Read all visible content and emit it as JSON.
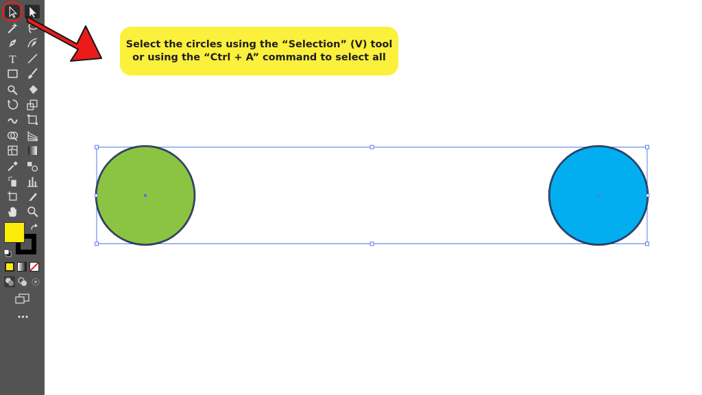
{
  "callout": {
    "line1": "Select the circles using the “Selection” (V) tool",
    "line2": "or using the “Ctrl + A” command to select all"
  },
  "toolbar": {
    "tools": [
      {
        "name": "selection-tool",
        "icon": "selection-arrow-icon",
        "active": true
      },
      {
        "name": "direct-selection-tool",
        "icon": "direct-selection-arrow-icon"
      },
      {
        "name": "magic-wand-tool",
        "icon": "magic-wand-icon"
      },
      {
        "name": "lasso-tool",
        "icon": "lasso-icon"
      },
      {
        "name": "pen-tool",
        "icon": "pen-icon"
      },
      {
        "name": "curvature-tool",
        "icon": "curvature-icon"
      },
      {
        "name": "type-tool",
        "icon": "type-icon",
        "glyph": "T"
      },
      {
        "name": "line-segment-tool",
        "icon": "line-segment-icon"
      },
      {
        "name": "rectangle-tool",
        "icon": "rectangle-icon"
      },
      {
        "name": "paintbrush-tool",
        "icon": "paintbrush-icon"
      },
      {
        "name": "shaper-tool",
        "icon": "shaper-icon"
      },
      {
        "name": "eraser-tool",
        "icon": "eraser-icon"
      },
      {
        "name": "rotate-tool",
        "icon": "rotate-icon"
      },
      {
        "name": "scale-tool",
        "icon": "scale-icon"
      },
      {
        "name": "warp-tool",
        "icon": "warp-icon"
      },
      {
        "name": "free-transform-tool",
        "icon": "free-transform-icon"
      },
      {
        "name": "shape-builder-tool",
        "icon": "shape-builder-icon"
      },
      {
        "name": "perspective-grid-tool",
        "icon": "perspective-grid-icon"
      },
      {
        "name": "mesh-tool",
        "icon": "mesh-icon"
      },
      {
        "name": "gradient-tool",
        "icon": "gradient-icon"
      },
      {
        "name": "eyedropper-tool",
        "icon": "eyedropper-icon"
      },
      {
        "name": "blend-tool",
        "icon": "blend-icon"
      },
      {
        "name": "symbol-sprayer-tool",
        "icon": "symbol-sprayer-icon"
      },
      {
        "name": "column-graph-tool",
        "icon": "column-graph-icon"
      },
      {
        "name": "artboard-tool",
        "icon": "artboard-icon"
      },
      {
        "name": "slice-tool",
        "icon": "slice-icon"
      },
      {
        "name": "hand-tool",
        "icon": "hand-icon"
      },
      {
        "name": "zoom-tool",
        "icon": "zoom-icon"
      }
    ],
    "fill_color": "#fcec0c",
    "stroke_color": "#000000",
    "swap_icon": "swap-arrow-icon",
    "default_colors_icon": "default-colors-icon",
    "color_modes": [
      "color-mode-icon",
      "gradient-mode-icon",
      "none-mode-icon"
    ],
    "draw_modes": [
      "draw-normal-icon",
      "draw-behind-icon",
      "draw-inside-icon"
    ],
    "screen_mode_icon": "screen-mode-icon",
    "more_tools_label": "•••"
  },
  "artwork": {
    "left_circle_fill": "#8bc443",
    "right_circle_fill": "#02aeef",
    "circle_stroke": "#111111",
    "selection_color": "#4f79f0",
    "annotation_color": "#ea1c1c"
  }
}
